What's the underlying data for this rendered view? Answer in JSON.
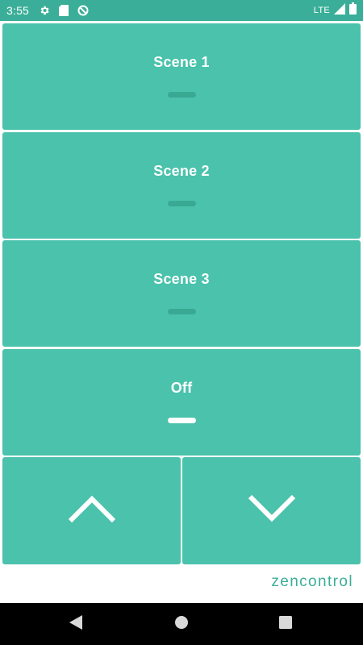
{
  "status_bar": {
    "time": "3:55",
    "network": "LTE",
    "icons": [
      "gear-icon",
      "sd-card-icon",
      "sync-off-icon",
      "signal-icon",
      "battery-icon"
    ],
    "color": "#3aae98"
  },
  "scenes": [
    {
      "label": "Scene 1",
      "active": false
    },
    {
      "label": "Scene 2",
      "active": false
    },
    {
      "label": "Scene 3",
      "active": false
    },
    {
      "label": "Off",
      "active": true
    }
  ],
  "controls": {
    "up_icon": "chevron-up-icon",
    "down_icon": "chevron-down-icon"
  },
  "brand": "zencontrol",
  "colors": {
    "tile": "#4ac2ac",
    "indicator_inactive": "#3aa994",
    "indicator_active": "#ffffff"
  },
  "nav_bar": {
    "icons": [
      "back-icon",
      "home-icon",
      "recents-icon"
    ]
  }
}
